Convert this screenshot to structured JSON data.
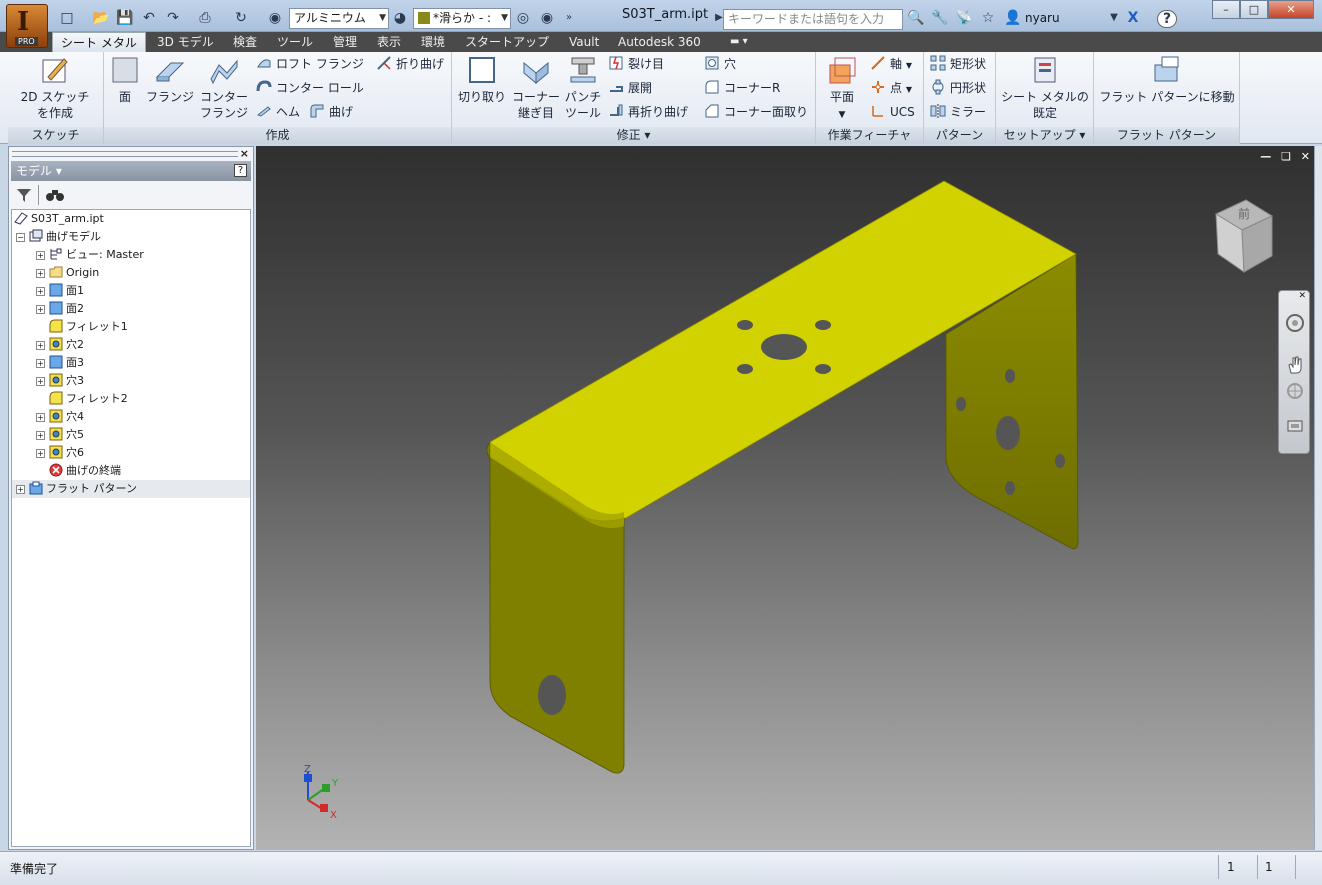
{
  "window": {
    "title": "S03T_arm.ipt",
    "app_badge": "PRO",
    "app_letter": "I",
    "search_placeholder": "キーワードまたは語句を入力",
    "user": "nyaru",
    "help_glyph": "?"
  },
  "quick_access": {
    "material": "アルミニウム",
    "appearance": "*滑らか - :"
  },
  "tabs": [
    {
      "label": "シート メタル",
      "active": true
    },
    {
      "label": "3D モデル"
    },
    {
      "label": "検査"
    },
    {
      "label": "ツール"
    },
    {
      "label": "管理"
    },
    {
      "label": "表示"
    },
    {
      "label": "環境"
    },
    {
      "label": "スタートアップ"
    },
    {
      "label": "Vault"
    },
    {
      "label": "Autodesk 360"
    }
  ],
  "ribbon": {
    "sketch": {
      "label": "スケッチ",
      "create_sketch_l1": "2D スケッチ",
      "create_sketch_l2": "を作成"
    },
    "create": {
      "label": "作成",
      "face": "面",
      "flange": "フランジ",
      "contour_flange_l1": "コンター",
      "contour_flange_l2": "フランジ",
      "loft_flange": "ロフト フランジ",
      "contour_roll": "コンター ロール",
      "hem": "ヘム",
      "fold": "折り曲げ",
      "bend": "曲げ"
    },
    "modify": {
      "label": "修正 ▾",
      "cut": "切り取り",
      "corner_seam_l1": "コーナー",
      "corner_seam_l2": "継ぎ目",
      "punch_tool_l1": "パンチ",
      "punch_tool_l2": "ツール",
      "rip": "裂け目",
      "unfold": "展開",
      "refold": "再折り曲げ",
      "hole": "穴",
      "corner_round": "コーナーR",
      "corner_chamfer": "コーナー面取り"
    },
    "work_features": {
      "label": "作業フィーチャ",
      "plane": "平面",
      "axis": "軸",
      "point": "点",
      "ucs": "UCS"
    },
    "pattern": {
      "label": "パターン",
      "rectangular": "矩形状",
      "circular": "円形状",
      "mirror": "ミラー"
    },
    "setup": {
      "label": "セットアップ ▾",
      "defaults_l1": "シート メタルの",
      "defaults_l2": "既定"
    },
    "flat_pattern": {
      "label": "フラット パターン",
      "go_to_flat": "フラット パターンに移動"
    }
  },
  "browser": {
    "title": "モデル ▾",
    "help": "?",
    "close": "×",
    "root": "S03T_arm.ipt",
    "items": [
      {
        "label": "曲げモデル",
        "level": 1,
        "exp": "−",
        "icon": "folded-model-icon"
      },
      {
        "label": "ビュー: Master",
        "level": 2,
        "exp": "+",
        "icon": "view-rep-icon"
      },
      {
        "label": "Origin",
        "level": 2,
        "exp": "+",
        "icon": "folder-icon"
      },
      {
        "label": "面1",
        "level": 2,
        "exp": "+",
        "icon": "face-feature-icon"
      },
      {
        "label": "面2",
        "level": 2,
        "exp": "+",
        "icon": "face-feature-icon"
      },
      {
        "label": "フィレット1",
        "level": 2,
        "exp": "",
        "icon": "fillet-icon"
      },
      {
        "label": "穴2",
        "level": 2,
        "exp": "+",
        "icon": "hole-icon"
      },
      {
        "label": "面3",
        "level": 2,
        "exp": "+",
        "icon": "face-feature-icon"
      },
      {
        "label": "穴3",
        "level": 2,
        "exp": "+",
        "icon": "hole-icon"
      },
      {
        "label": "フィレット2",
        "level": 2,
        "exp": "",
        "icon": "fillet-icon"
      },
      {
        "label": "穴4",
        "level": 2,
        "exp": "+",
        "icon": "hole-icon"
      },
      {
        "label": "穴5",
        "level": 2,
        "exp": "+",
        "icon": "hole-icon"
      },
      {
        "label": "穴6",
        "level": 2,
        "exp": "+",
        "icon": "hole-icon"
      },
      {
        "label": "曲げの終端",
        "level": 2,
        "exp": "",
        "icon": "end-of-folded-icon"
      },
      {
        "label": "フラット パターン",
        "level": 1,
        "exp": "+",
        "icon": "flat-pattern-icon"
      }
    ]
  },
  "viewcube": {
    "face_label": "前"
  },
  "triad": {
    "x": "X",
    "y": "Y",
    "z": "Z"
  },
  "status": {
    "text": "準備完了",
    "val1": "1",
    "val2": "1"
  },
  "colors": {
    "part_top": "#d2d200",
    "part_side": "#7a7a00",
    "part_face": "#9c9c00",
    "accent": "#1f5fbf"
  }
}
